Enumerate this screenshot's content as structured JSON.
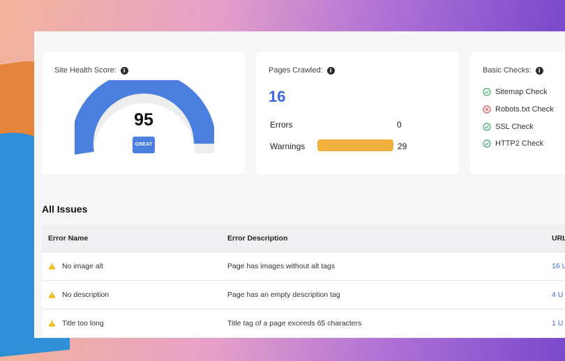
{
  "cards": {
    "health": {
      "title": "Site Health Score:",
      "score": "95",
      "score_value": 95,
      "badge": "GREAT"
    },
    "pages": {
      "title": "Pages Crawled:",
      "count": "16",
      "rows": [
        {
          "label": "Errors",
          "value": "0"
        },
        {
          "label": "Warnings",
          "value": "29"
        }
      ]
    },
    "checks": {
      "title": "Basic Checks:",
      "items": [
        {
          "label": "Sitemap Check",
          "status": "pass"
        },
        {
          "label": "Robots.txt Check",
          "status": "fail"
        },
        {
          "label": "SSL Check",
          "status": "pass"
        },
        {
          "label": "HTTP2 Check",
          "status": "pass"
        }
      ]
    }
  },
  "issues": {
    "title": "All Issues",
    "columns": [
      "Error Name",
      "Error Description",
      "URL"
    ],
    "rows": [
      {
        "name": "No image alt",
        "description": "Page has images without alt tags",
        "urls": "16 U"
      },
      {
        "name": "No description",
        "description": "Page has an empty description tag",
        "urls": "4 U"
      },
      {
        "name": "Title too long",
        "description": "Title tag of a page exceeds 65 characters",
        "urls": "1 U"
      }
    ]
  },
  "colors": {
    "accent": "#3a67e0",
    "gauge": "#4a7fe0",
    "warning_bar": "#f2b03f",
    "pass": "#3aa86b",
    "fail": "#d9534f"
  }
}
